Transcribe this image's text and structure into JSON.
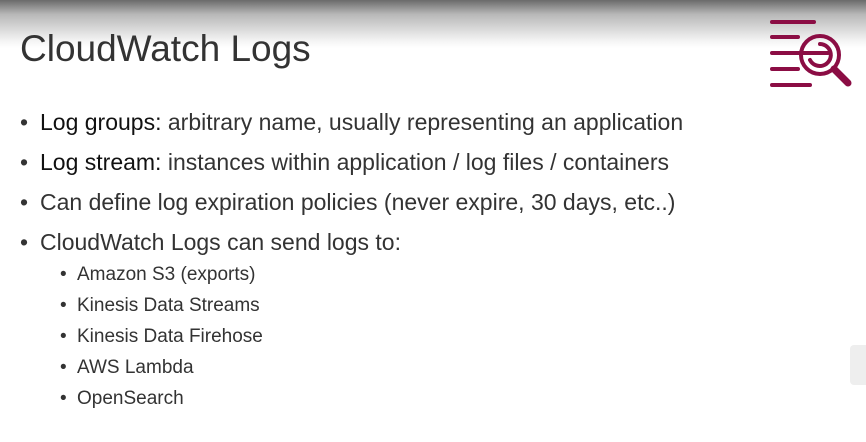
{
  "slide": {
    "title": "CloudWatch Logs",
    "accent": "#8b0d44",
    "bullets": [
      {
        "term": "Log groups:",
        "text": " arbitrary name, usually representing an application"
      },
      {
        "term": "Log stream:",
        "text": " instances within application / log files / containers"
      },
      {
        "term": "",
        "text": "Can define log expiration policies (never expire, 30 days, etc..)"
      },
      {
        "term": "",
        "text": "CloudWatch Logs can send logs to:"
      }
    ],
    "sub_bullets": [
      "Amazon S3 (exports)",
      "Kinesis Data Streams",
      "Kinesis Data Firehose",
      "AWS Lambda",
      "OpenSearch"
    ]
  }
}
